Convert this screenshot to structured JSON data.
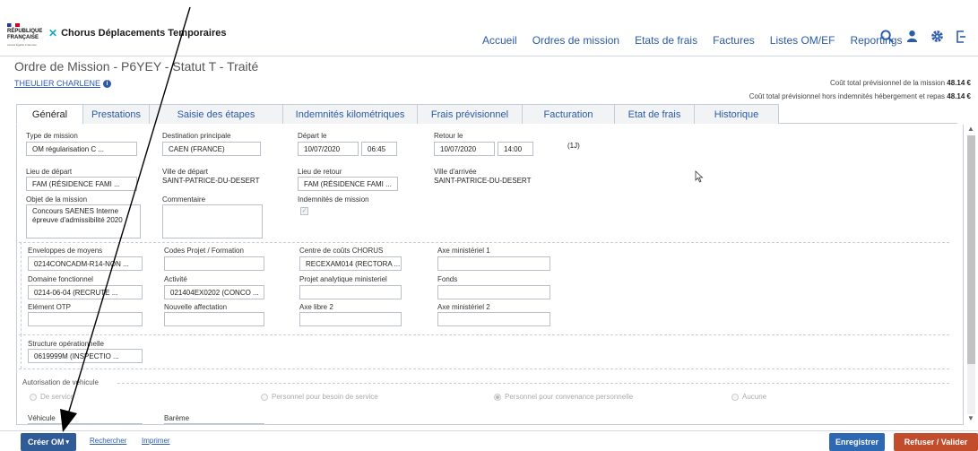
{
  "header": {
    "logo": {
      "line1": "RÉPUBLIQUE",
      "line2": "FRANÇAISE",
      "motto": "Liberté Égalité Fraternité"
    },
    "app_name": "Chorus Déplacements Temporaires",
    "nav": [
      "Accueil",
      "Ordres de mission",
      "Etats de frais",
      "Factures",
      "Listes OM/EF",
      "Reportings"
    ],
    "icons": [
      "search-icon",
      "user-icon",
      "gear-icon",
      "logout-icon"
    ]
  },
  "page": {
    "title": "Ordre de Mission - P6YEY - Statut T - Traité",
    "user": "THEULIER CHARLENE",
    "cost_total_label": "Coût total prévisionnel de la mission",
    "cost_total_value": "48.14 €",
    "cost_excl_label": "Coût total prévisionnel hors indemnités hébergement et repas",
    "cost_excl_value": "48.14 €"
  },
  "tabs": [
    "Général",
    "Prestations",
    "Saisie des étapes",
    "Indemnités kilométriques",
    "Frais prévisionnel",
    "Facturation",
    "Etat de frais",
    "Historique"
  ],
  "form": {
    "type_mission": {
      "label": "Type de mission",
      "value": "OM régularisation C ..."
    },
    "destination": {
      "label": "Destination principale",
      "value": "CAEN (FRANCE)"
    },
    "depart": {
      "label": "Départ le",
      "date": "10/07/2020",
      "time": "06:45"
    },
    "retour": {
      "label": "Retour le",
      "date": "10/07/2020",
      "time": "14:00"
    },
    "duration": "(1J)",
    "lieu_depart": {
      "label": "Lieu de départ",
      "value": "FAM (RÉSIDENCE FAMI ..."
    },
    "ville_depart": {
      "label": "Ville de départ",
      "value": "SAINT-PATRICE-DU-DESERT"
    },
    "lieu_retour": {
      "label": "Lieu de retour",
      "value": "FAM (RÉSIDENCE FAMI ..."
    },
    "ville_arrivee": {
      "label": "Ville d'arrivée",
      "value": "SAINT-PATRICE-DU-DESERT"
    },
    "objet": {
      "label": "Objet de la mission",
      "value": "Concours SAENES Interne épreuve d'admissibilité 2020"
    },
    "commentaire": {
      "label": "Commentaire",
      "value": ""
    },
    "indemnites": {
      "label": "Indemnités de mission",
      "checked": true
    },
    "enveloppes": {
      "label": "Enveloppes de moyens",
      "value": "0214CONCADM-R14-NON ..."
    },
    "codes_projet": {
      "label": "Codes Projet / Formation",
      "value": ""
    },
    "centre_couts": {
      "label": "Centre de coûts CHORUS",
      "value": "RECEXAM014 (RECTORA ..."
    },
    "axe_min1": {
      "label": "Axe ministériel 1",
      "value": ""
    },
    "domaine": {
      "label": "Domaine fonctionnel",
      "value": "0214-06-04 (RECRUTE ..."
    },
    "activite": {
      "label": "Activité",
      "value": "021404EX0202 (CONCO ..."
    },
    "projet_analytique": {
      "label": "Projet analytique ministeriel",
      "value": ""
    },
    "fonds": {
      "label": "Fonds",
      "value": ""
    },
    "element_otp": {
      "label": "Elément OTP",
      "value": ""
    },
    "nouvelle_affectation": {
      "label": "Nouvelle affectation",
      "value": ""
    },
    "axe_libre2": {
      "label": "Axe libre 2",
      "value": ""
    },
    "axe_min2": {
      "label": "Axe ministériel 2",
      "value": ""
    },
    "structure": {
      "label": "Structure opérationnelle",
      "value": "0619999M (INSPECTIO ..."
    },
    "autorisation": {
      "label": "Autorisation de véhicule",
      "options": [
        "De service",
        "Personnel pour besoin de service",
        "Personnel pour convenance personnelle",
        "Aucune"
      ],
      "selected": "Personnel pour convenance personnelle"
    },
    "vehicule": {
      "label": "Véhicule"
    },
    "bareme": {
      "label": "Barème"
    }
  },
  "footer": {
    "create": "Créer OM",
    "search": "Rechercher",
    "print": "Imprimer",
    "save": "Enregistrer",
    "refuse": "Refuser / Valider"
  },
  "colors": {
    "link": "#2a5aa8",
    "primary": "#2e67b2",
    "danger": "#c24d2c"
  }
}
